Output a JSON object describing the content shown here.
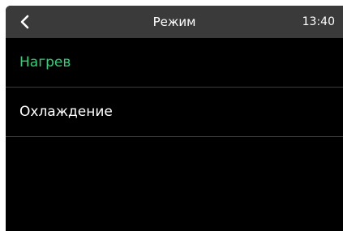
{
  "header": {
    "title": "Режим",
    "time": "13:40",
    "back_icon": "chevron-left-icon"
  },
  "modes": {
    "items": [
      {
        "label": "Нагрев",
        "selected": true
      },
      {
        "label": "Охлаждение",
        "selected": false
      }
    ]
  },
  "colors": {
    "header_bg": "#3a3a3a",
    "screen_bg": "#000000",
    "selected_text": "#2fd17b",
    "text": "#ffffff"
  }
}
